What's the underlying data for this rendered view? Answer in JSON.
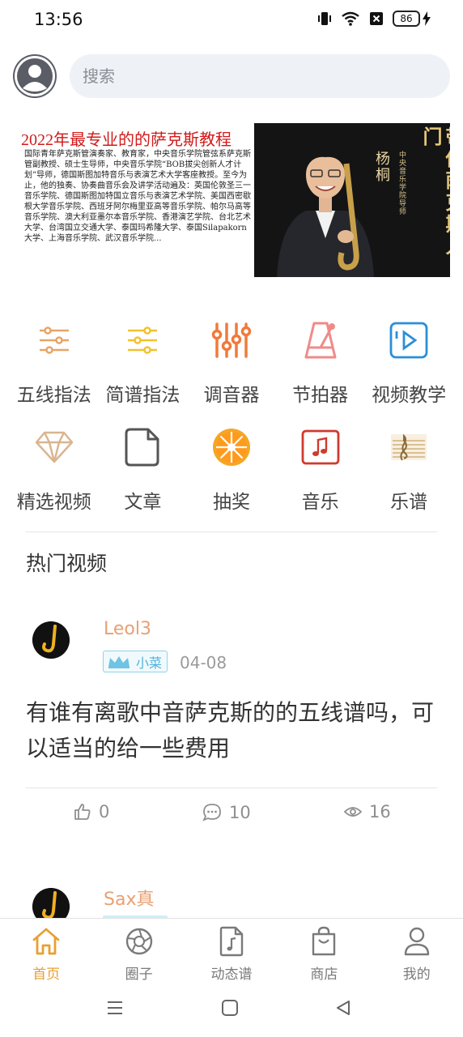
{
  "status_bar": {
    "time": "13:56",
    "battery": "86",
    "icons": [
      "vibrate-icon",
      "wifi-icon",
      "sim-blocked-icon",
      "battery-icon",
      "charging-icon"
    ]
  },
  "search": {
    "placeholder": "搜索"
  },
  "banner": {
    "title": "2022年最专业的的萨克斯教程",
    "description": "国际青年萨克斯管演奏家、教育家，中央音乐学院管弦系萨克斯管副教授、硕士生导师，中央音乐学院“BOB拔尖创新人才计划”导师，德国斯图加特音乐与表演艺术大学客座教授。至今为止，他的独奏、协奏曲音乐会及讲学活动遍及：英国伦敦圣三一音乐学院、德国斯图加特国立音乐与表演艺术学院、美国西密歇根大学音乐学院、西班牙阿尔梅里亚高等音乐学院、帕尔马高等音乐学院、澳大利亚墨尔本音乐学院、香港演艺学院、台北艺术大学、台湾国立交通大学、泰国玛希隆大学、泰国Silapakorn大学、上海音乐学院、武汉音乐学院...",
    "teacher_name": "杨桐",
    "teacher_title": "中央音乐学院导师",
    "slogan": "带你萨克斯入门"
  },
  "grid": {
    "row1": [
      {
        "label": "五线指法",
        "icon": "sliders-icon",
        "color": "#e8a466"
      },
      {
        "label": "简谱指法",
        "icon": "sliders-icon",
        "color": "#f2c12e"
      },
      {
        "label": "调音器",
        "icon": "equalizer-icon",
        "color": "#f07a3a"
      },
      {
        "label": "节拍器",
        "icon": "metronome-icon",
        "color": "#f08a8a"
      },
      {
        "label": "视频教学",
        "icon": "video-play-icon",
        "color": "#2a8fd8"
      }
    ],
    "row2": [
      {
        "label": "精选视频",
        "icon": "diamond-icon",
        "color": "#d8b690"
      },
      {
        "label": "文章",
        "icon": "document-icon",
        "color": "#555555"
      },
      {
        "label": "抽奖",
        "icon": "lottery-wheel-icon",
        "color": "#f5a623"
      },
      {
        "label": "音乐",
        "icon": "music-note-icon",
        "color": "#d03a2e"
      },
      {
        "label": "乐谱",
        "icon": "sheet-music-icon",
        "color": "#c9a46a"
      }
    ]
  },
  "hot_videos": {
    "title": "热门视频"
  },
  "posts": [
    {
      "user": "Leol3",
      "badge": "小菜",
      "date": "04-08",
      "text": "有谁有离歌中音萨克斯的的五线谱吗，可以适当的给一些费用",
      "likes": "0",
      "comments": "10",
      "views": "16"
    },
    {
      "user": "Sax真"
    }
  ],
  "tab_bar": {
    "tabs": [
      {
        "label": "首页",
        "icon": "home-icon",
        "active": true
      },
      {
        "label": "圈子",
        "icon": "aperture-icon",
        "active": false
      },
      {
        "label": "动态谱",
        "icon": "music-file-icon",
        "active": false
      },
      {
        "label": "商店",
        "icon": "shopping-bag-icon",
        "active": false
      },
      {
        "label": "我的",
        "icon": "user-icon",
        "active": false
      }
    ],
    "active_color": "#e8a033"
  },
  "system_nav": {
    "buttons": [
      "menu-icon",
      "home-square-icon",
      "back-triangle-icon"
    ]
  }
}
